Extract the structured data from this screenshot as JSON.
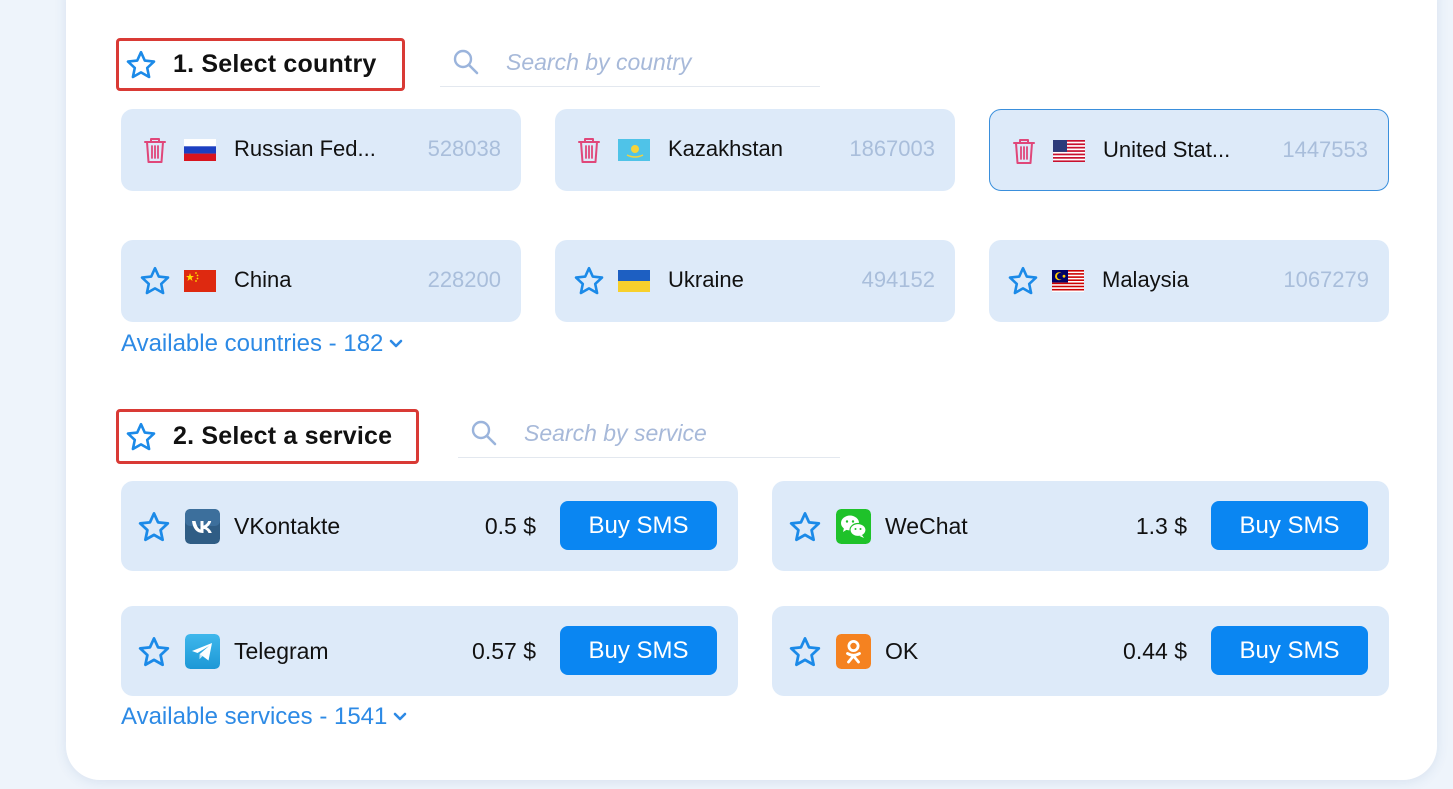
{
  "countries_section": {
    "title": "1. Select country",
    "search_placeholder": "Search by country",
    "items": [
      {
        "name": "Russian Fed...",
        "count": "528038",
        "action": "trash-icon",
        "flag": "russia"
      },
      {
        "name": "Kazakhstan",
        "count": "1867003",
        "action": "trash-icon",
        "flag": "kazakhstan"
      },
      {
        "name": "United Stat...",
        "count": "1447553",
        "action": "trash-icon",
        "flag": "usa",
        "selected": true
      },
      {
        "name": "China",
        "count": "228200",
        "action": "star-icon",
        "flag": "china"
      },
      {
        "name": "Ukraine",
        "count": "494152",
        "action": "star-icon",
        "flag": "ukraine"
      },
      {
        "name": "Malaysia",
        "count": "1067279",
        "action": "star-icon",
        "flag": "malaysia"
      }
    ],
    "more_label": "Available countries - 182"
  },
  "services_section": {
    "title": "2. Select a service",
    "search_placeholder": "Search by service",
    "items": [
      {
        "name": "VKontakte",
        "price": "0.5 $",
        "button": "Buy SMS",
        "logo": "vk-logo"
      },
      {
        "name": "WeChat",
        "price": "1.3 $",
        "button": "Buy SMS",
        "logo": "wechat-logo"
      },
      {
        "name": "Telegram",
        "price": "0.57 $",
        "button": "Buy SMS",
        "logo": "telegram-logo"
      },
      {
        "name": "OK",
        "price": "0.44 $",
        "button": "Buy SMS",
        "logo": "ok-logo"
      }
    ],
    "more_label": "Available services - 1541"
  },
  "colors": {
    "accent": "#0a86f2",
    "link": "#2d8ae5",
    "tile_bg": "#ddeaf9",
    "count_text": "#a9bedb",
    "trash": "#e0477a",
    "highlight_border": "#d93a35"
  }
}
